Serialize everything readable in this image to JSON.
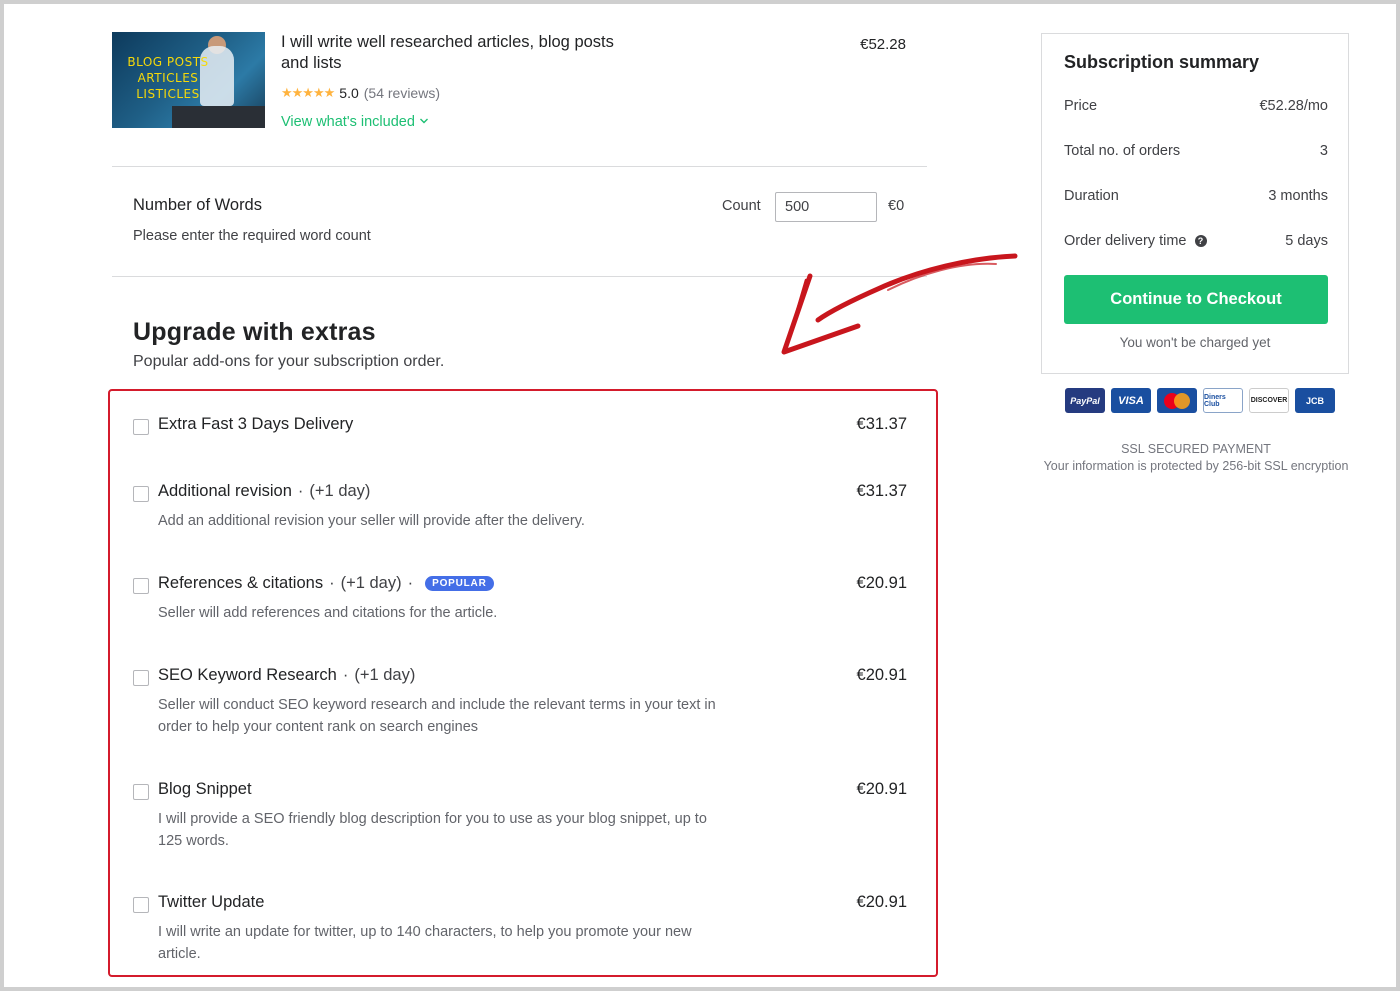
{
  "gig": {
    "thumbnail_text": [
      "BLOG POSTS",
      "ARTICLES",
      "LISTICLES"
    ],
    "title": "I will write well researched articles, blog posts and lists",
    "price": "€52.28",
    "stars": "★★★★★",
    "rating": "5.0",
    "reviews": "(54 reviews)",
    "included_link": "View what's included"
  },
  "words": {
    "title": "Number of Words",
    "subtitle": "Please enter the required word count",
    "count_label": "Count",
    "count_value": "500",
    "price": "€0"
  },
  "upgrade": {
    "title": "Upgrade with extras",
    "subtitle": "Popular add-ons for your subscription order.",
    "extras": [
      {
        "name": "Extra Fast 3 Days Delivery",
        "days": "",
        "badge": "",
        "price": "€31.37",
        "desc": ""
      },
      {
        "name": "Additional revision",
        "days": "(+1 day)",
        "badge": "",
        "price": "€31.37",
        "desc": "Add an additional revision your seller will provide after the delivery."
      },
      {
        "name": "References & citations",
        "days": "(+1 day)",
        "badge": "POPULAR",
        "price": "€20.91",
        "desc": "Seller will add references and citations for the article."
      },
      {
        "name": "SEO Keyword Research",
        "days": "(+1 day)",
        "badge": "",
        "price": "€20.91",
        "desc": "Seller will conduct SEO keyword research and include the relevant terms in your text in order to help your content rank on search engines"
      },
      {
        "name": "Blog Snippet",
        "days": "",
        "badge": "",
        "price": "€20.91",
        "desc": "I will provide a SEO friendly blog description for you to use as your blog snippet, up to 125 words."
      },
      {
        "name": "Twitter Update",
        "days": "",
        "badge": "",
        "price": "€20.91",
        "desc": "I will write an update for twitter, up to 140 characters, to help you promote your new article."
      }
    ]
  },
  "summary": {
    "title": "Subscription summary",
    "rows": [
      {
        "label": "Price",
        "value": "€52.28/mo"
      },
      {
        "label": "Total no. of orders",
        "value": "3"
      },
      {
        "label": "Duration",
        "value": "3 months"
      },
      {
        "label": "Order delivery time",
        "value": "5 days"
      }
    ],
    "checkout_label": "Continue to Checkout",
    "no_charge": "You won't be charged yet"
  },
  "payment": {
    "cards": [
      "PayPal",
      "VISA",
      "mastercard",
      "Diners Club",
      "DISCOVER",
      "JCB"
    ],
    "ssl_title": "SSL SECURED PAYMENT",
    "ssl_desc": "Your information is protected by 256-bit SSL encryption"
  },
  "colors": {
    "accent_green": "#1dbf73",
    "highlight_red": "#d41b2c",
    "badge_blue": "#446ee7",
    "star": "#ffb33e"
  }
}
